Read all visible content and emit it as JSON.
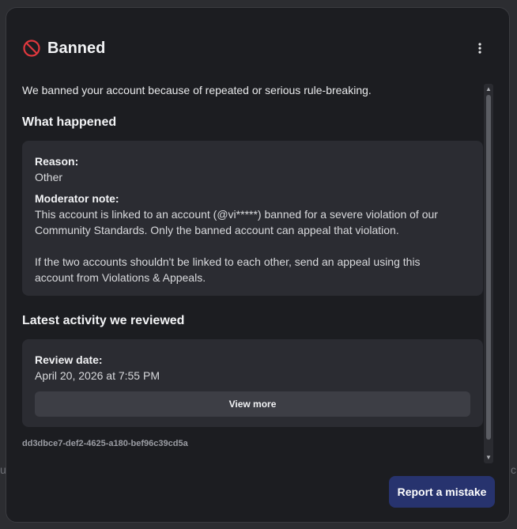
{
  "background": {
    "left_fragment": "u",
    "right_fragment": "c"
  },
  "modal": {
    "title": "Banned",
    "title_icon": "ban-icon",
    "menu_icon": "kebab-icon",
    "intro": "We banned your account because of repeated or serious rule-breaking.",
    "what_happened": {
      "heading": "What happened",
      "reason_label": "Reason:",
      "reason_value": "Other",
      "note_label": "Moderator note:",
      "note_text": "This account is linked to an account (@vi*****) banned for a severe violation of our\nCommunity Standards. Only the banned account can appeal that violation.\n\nIf the two accounts shouldn't be linked to each other, send an appeal using this\naccount from Violations & Appeals."
    },
    "latest_activity": {
      "heading": "Latest activity we reviewed",
      "review_label": "Review date:",
      "review_value": "April 20, 2026 at 7:55 PM",
      "view_more_label": "View more"
    },
    "reference_id": "dd3dbce7-def2-4625-a180-bef96c39cd5a",
    "report_button_label": "Report a mistake"
  },
  "colors": {
    "report_button": "#27336e",
    "ban_icon": "#e0383e",
    "modal_bg": "#1c1d21",
    "card_bg": "#2b2c32"
  }
}
